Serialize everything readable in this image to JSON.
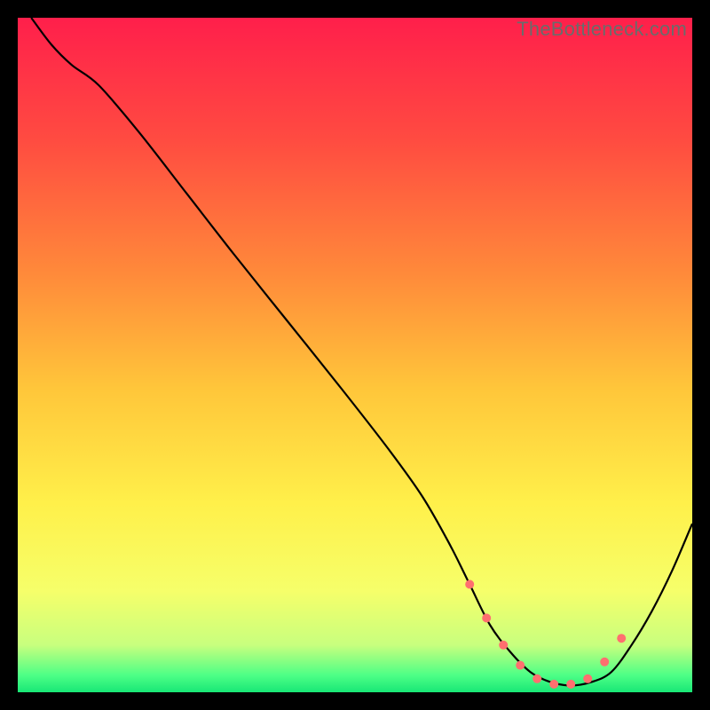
{
  "watermark": "TheBottleneck.com",
  "chart_data": {
    "type": "line",
    "title": "",
    "xlabel": "",
    "ylabel": "",
    "xlim": [
      0,
      100
    ],
    "ylim": [
      0,
      100
    ],
    "background_gradient": {
      "stops": [
        {
          "offset": 0.0,
          "color": "#ff1f4b"
        },
        {
          "offset": 0.18,
          "color": "#ff4b41"
        },
        {
          "offset": 0.38,
          "color": "#ff8a3a"
        },
        {
          "offset": 0.55,
          "color": "#ffc63a"
        },
        {
          "offset": 0.72,
          "color": "#fff04a"
        },
        {
          "offset": 0.85,
          "color": "#f6ff6a"
        },
        {
          "offset": 0.93,
          "color": "#c8ff7e"
        },
        {
          "offset": 0.975,
          "color": "#4dff86"
        },
        {
          "offset": 1.0,
          "color": "#18e776"
        }
      ]
    },
    "series": [
      {
        "name": "bottleneck-curve",
        "color": "#000000",
        "x": [
          2,
          5,
          8,
          12,
          18,
          25,
          32,
          40,
          48,
          55,
          60,
          64,
          67,
          70,
          73,
          76,
          79,
          82,
          85,
          88,
          91,
          94,
          97,
          100
        ],
        "y": [
          100,
          96,
          93,
          90,
          83,
          74,
          65,
          55,
          45,
          36,
          29,
          22,
          16,
          10,
          6,
          3,
          1.5,
          1,
          1.5,
          3,
          7,
          12,
          18,
          25
        ]
      }
    ],
    "markers": {
      "name": "optimal-range-dots",
      "color": "#ff6f6f",
      "radius": 5,
      "x": [
        67,
        69.5,
        72,
        74.5,
        77,
        79.5,
        82,
        84.5,
        87,
        89.5
      ],
      "y": [
        16,
        11,
        7,
        4,
        2,
        1.2,
        1.2,
        2,
        4.5,
        8
      ]
    }
  }
}
